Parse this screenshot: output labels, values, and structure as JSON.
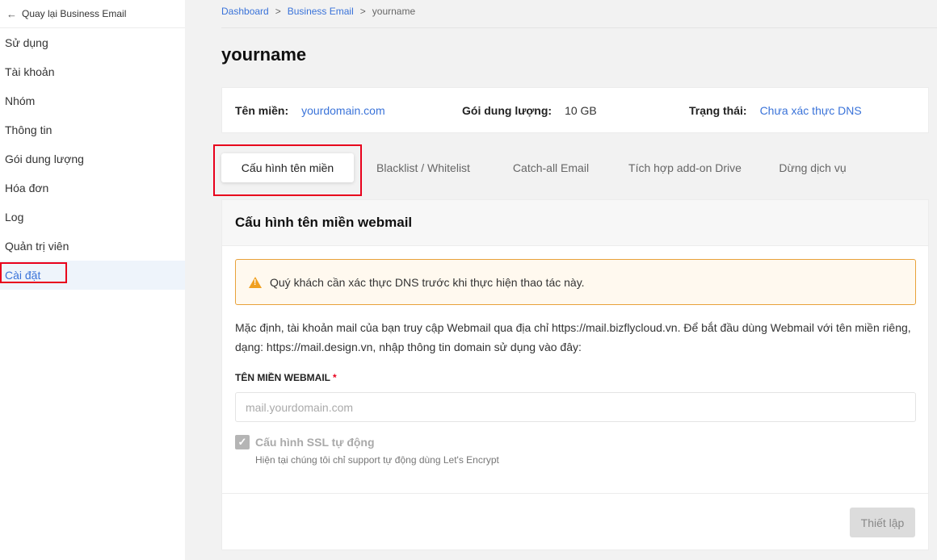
{
  "sidebar": {
    "back_label": "Quay lại Business Email",
    "items": [
      {
        "label": "Sử dụng"
      },
      {
        "label": "Tài khoản"
      },
      {
        "label": "Nhóm"
      },
      {
        "label": "Thông tin"
      },
      {
        "label": "Gói dung lượng"
      },
      {
        "label": "Hóa đơn"
      },
      {
        "label": "Log"
      },
      {
        "label": "Quản trị viên"
      },
      {
        "label": "Cài đặt"
      }
    ]
  },
  "breadcrumb": {
    "items": [
      "Dashboard",
      "Business Email"
    ],
    "current": "yourname",
    "separator": ">"
  },
  "page_title": "yourname",
  "info": {
    "domain_label": "Tên miền:",
    "domain_value": "yourdomain.com",
    "plan_label": "Gói dung lượng:",
    "plan_value": "10 GB",
    "status_label": "Trạng thái:",
    "status_value": "Chưa xác thực DNS"
  },
  "tabs": [
    {
      "label": "Cấu hình tên miền"
    },
    {
      "label": "Blacklist / Whitelist"
    },
    {
      "label": "Catch-all Email"
    },
    {
      "label": "Tích hợp add-on Drive"
    },
    {
      "label": "Dừng dịch vụ"
    }
  ],
  "config": {
    "title": "Cấu hình tên miền webmail",
    "alert": "Quý khách cần xác thực DNS trước khi thực hiện thao tác này.",
    "description": "Mặc định, tài khoản mail của bạn truy cập Webmail qua địa chỉ https://mail.bizflycloud.vn. Để bắt đầu dùng Webmail với tên miền riêng, dạng: https://mail.design.vn, nhập thông tin domain sử dụng vào đây:",
    "field_label": "TÊN MIỀN WEBMAIL",
    "field_required": "*",
    "field_placeholder": "mail.yourdomain.com",
    "ssl_label": "Cấu hình SSL tự động",
    "ssl_hint": "Hiện tại chúng tôi chỉ support tự động dùng Let's Encrypt",
    "submit_label": "Thiết lập"
  },
  "colors": {
    "accent": "#3a73d9",
    "highlight": "#e8001c",
    "warning": "#f0a020"
  }
}
